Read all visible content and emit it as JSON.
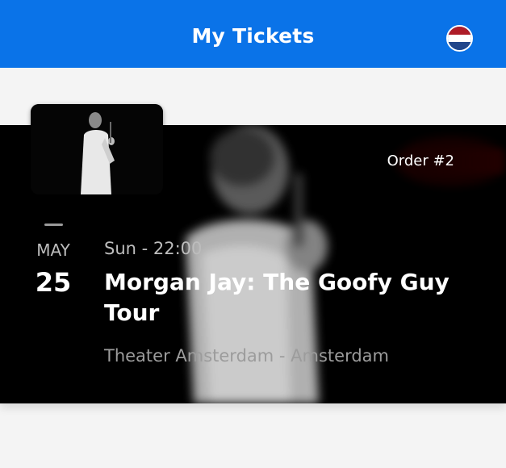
{
  "header": {
    "title": "My Tickets",
    "flag_icon": "netherlands-flag-icon",
    "background_color": "#0a73e8",
    "flag_colors": [
      "#ae1c28",
      "#ffffff",
      "#21468b"
    ]
  },
  "ticket": {
    "order_label": "Order #2",
    "date_month": "MAY",
    "date_day": "25",
    "time": "Sun - 22:00",
    "title": "Morgan Jay: The Goofy Guy Tour",
    "venue": "Theater Amsterdam - Amsterdam",
    "image_icon": "performer-photo"
  }
}
